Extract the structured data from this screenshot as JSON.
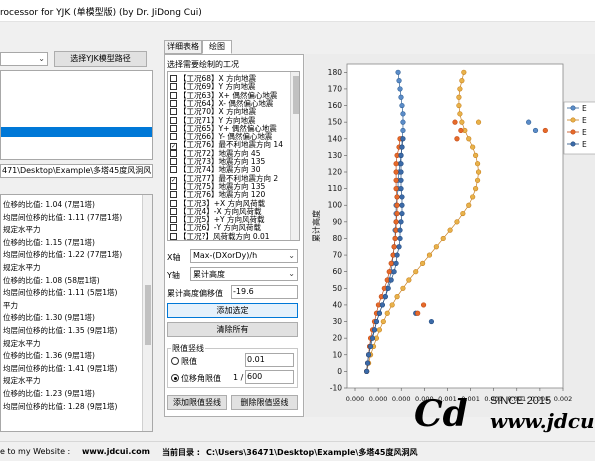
{
  "window": {
    "title": "rocessor for YJK (单模型版) (by Dr. JiDong Cui)"
  },
  "left": {
    "model_path_button": "选择YJK模型路径",
    "path_value": "471\\Desktop\\Example\\多塔45度风洞风",
    "results": [
      "位移的比值: 1.04 (7层1塔)",
      "均层间位移的比值: 1.11 (77层1塔)",
      "规定水平力",
      "位移的比值: 1.15 (7层1塔)",
      "均层间位移的比值: 1.22 (77层1塔)",
      "规定水平力",
      "位移的比值: 1.08 (58层1塔)",
      "均层间位移的比值: 1.11 (5层1塔)",
      "平力",
      "位移的比值: 1.30 (9层1塔)",
      "均层间位移的比值: 1.35 (9层1塔)",
      "规定水平力",
      "位移的比值: 1.36 (9层1塔)",
      "均层间位移的比值: 1.41 (9层1塔)",
      "规定水平力",
      "位移的比值: 1.23 (9层1塔)",
      "均层间位移的比值: 1.28 (9层1塔)"
    ]
  },
  "tabs": {
    "details": "详细表格",
    "plot": "绘图"
  },
  "panel": {
    "cases_label": "选择需要绘制的工况",
    "cases": [
      {
        "label": "【工况68】X 方向地震",
        "checked": false
      },
      {
        "label": "【工况69】Y 方向地震",
        "checked": false
      },
      {
        "label": "【工况63】X+ 偶然偏心地震",
        "checked": false
      },
      {
        "label": "【工况64】X- 偶然偏心地震",
        "checked": false
      },
      {
        "label": "【工况70】X 方向地震",
        "checked": false
      },
      {
        "label": "【工况71】Y 方向地震",
        "checked": false
      },
      {
        "label": "【工况65】Y+ 偶然偏心地震",
        "checked": false
      },
      {
        "label": "【工况66】Y- 偶然偏心地震",
        "checked": false
      },
      {
        "label": "【工况76】最不利地震方向 14",
        "checked": true
      },
      {
        "label": "【工况72】地震方向 45",
        "checked": false
      },
      {
        "label": "【工况73】地震方向 135",
        "checked": false
      },
      {
        "label": "【工况74】地震方向 30",
        "checked": false
      },
      {
        "label": "【工况77】最不利地震方向 2",
        "checked": true
      },
      {
        "label": "【工况75】地震方向 135",
        "checked": false
      },
      {
        "label": "【工况76】地震方向 120",
        "checked": false
      },
      {
        "label": "【工况3】+X 方向风荷载",
        "checked": false
      },
      {
        "label": "【工况4】-X 方向风荷载",
        "checked": false
      },
      {
        "label": "【工况5】+Y 方向风荷载",
        "checked": false
      },
      {
        "label": "【工况6】-Y 方向风荷载",
        "checked": false
      },
      {
        "label": "【工况?】风荷载方向 0.01",
        "checked": false
      }
    ],
    "x_axis_label": "X轴",
    "x_axis_value": "Max-(DXorDy)/h",
    "y_axis_label": "Y轴",
    "y_axis_value": "累计高度",
    "offset_label": "累计高度偏移值",
    "offset_value": "-19.6",
    "add_button": "添加选定",
    "clear_button": "清除所有",
    "limit_group_label": "限值竖线",
    "limit_option": "限值",
    "limit_value": "0.01",
    "drift_option": "位移角限值",
    "drift_prefix": "1 /",
    "drift_value": "600",
    "add_limit_button": "添加限值竖线",
    "remove_limit_button": "删除限值竖线"
  },
  "status": {
    "welcome": "e to my Website :",
    "site": "www.jdcui.com",
    "dir_label": "当前目录 :",
    "dir_value": "C:\\Users\\36471\\Desktop\\Example\\多塔45度风洞风"
  },
  "watermark": {
    "since": "SINCE 2015",
    "url": "www.jdcu"
  },
  "chart_data": {
    "type": "scatter",
    "ylabel": "累计高度",
    "xlabel": "",
    "ylim": [
      -10,
      185
    ],
    "xlim": [
      -0.0002,
      0.002
    ],
    "yticks": [
      -10,
      0,
      10,
      20,
      30,
      40,
      50,
      60,
      70,
      80,
      90,
      100,
      110,
      120,
      130,
      140,
      150,
      160,
      170,
      180
    ],
    "xticks": [
      "0.000",
      "0.000",
      "0.000",
      "0.000",
      "0.001",
      "0.001",
      "0.001",
      "0.001",
      "0.001",
      "0.002"
    ],
    "legend_entries": [
      "E",
      "E",
      "E",
      "E"
    ],
    "legend_placement": "right",
    "colors": {
      "blue": "#3a6fa8",
      "orange": "#e06a2a",
      "blue_fill": "#3d78b5",
      "orange_fill": "#f08030",
      "gold": "#d49a28"
    },
    "series": [
      {
        "color": "#2f5f95",
        "fill": "#5b8cc8",
        "y": [
          180,
          175,
          170,
          165,
          160,
          155,
          150,
          145,
          140,
          135,
          130,
          125,
          120,
          115,
          110,
          105,
          100,
          95,
          90,
          85,
          80,
          75,
          70,
          65,
          60,
          55,
          50,
          45,
          40,
          35,
          30,
          25,
          20,
          15,
          10,
          5,
          0
        ],
        "x": [
          0.00032,
          0.00033,
          0.00034,
          0.00035,
          0.00036,
          0.00037,
          0.00037,
          0.00037,
          0.00036,
          0.00036,
          0.00035,
          0.00034,
          0.00033,
          0.00032,
          0.00032,
          0.00031,
          0.0003,
          0.0003,
          0.0003,
          0.00029,
          0.00029,
          0.00028,
          0.00027,
          0.00026,
          0.00025,
          0.00023,
          0.00021,
          0.00019,
          0.00016,
          0.00013,
          0.0001,
          8e-05,
          5e-05,
          3e-05,
          2e-05,
          1e-05,
          0.0
        ]
      },
      {
        "color": "#c8801f",
        "fill": "#e8b24a",
        "y": [
          180,
          175,
          170,
          165,
          160,
          155,
          150,
          145,
          140,
          135,
          130,
          125,
          120,
          115,
          110,
          105,
          100,
          95,
          90,
          85,
          80,
          75,
          70,
          65,
          60,
          55,
          50,
          45,
          40,
          35,
          30,
          25,
          20,
          15,
          10,
          5,
          0
        ],
        "x": [
          0.00099,
          0.00097,
          0.00095,
          0.00094,
          0.00094,
          0.00095,
          0.00097,
          0.001,
          0.00104,
          0.00108,
          0.00111,
          0.00113,
          0.00114,
          0.00113,
          0.00111,
          0.00108,
          0.00104,
          0.00098,
          0.00092,
          0.00085,
          0.00078,
          0.00071,
          0.00064,
          0.00057,
          0.0005,
          0.00043,
          0.00037,
          0.00031,
          0.00026,
          0.00021,
          0.00017,
          0.00013,
          0.0001,
          7e-05,
          4e-05,
          2e-05,
          0.0
        ]
      },
      {
        "color": "#c04a15",
        "fill": "#e66a2a",
        "y": [
          140,
          135,
          130,
          125,
          120,
          115,
          110,
          105,
          100,
          95,
          90,
          85,
          80,
          75,
          70,
          65,
          60,
          55,
          50,
          45,
          40,
          35,
          30,
          25,
          20,
          15,
          10,
          5,
          0
        ],
        "x": [
          0.00034,
          0.00033,
          0.00031,
          0.0003,
          0.0003,
          0.0003,
          0.0003,
          0.00031,
          0.00031,
          0.00031,
          0.0003,
          0.0003,
          0.00029,
          0.00028,
          0.00027,
          0.00025,
          0.00023,
          0.00021,
          0.00018,
          0.00015,
          0.00012,
          0.0001,
          8e-05,
          6e-05,
          4e-05,
          3e-05,
          2e-05,
          1e-05,
          0.0
        ]
      },
      {
        "color": "#244d80",
        "fill": "#3b6aa8",
        "y": [
          140,
          135,
          130,
          125,
          120,
          115,
          110,
          105,
          100,
          95,
          90,
          85,
          80,
          75,
          70,
          65,
          60,
          55,
          50,
          45,
          40,
          35,
          30,
          25,
          20,
          15,
          10,
          5,
          0
        ],
        "x": [
          0.00037,
          0.00036,
          0.00035,
          0.00035,
          0.00035,
          0.00035,
          0.00035,
          0.00036,
          0.00036,
          0.00036,
          0.00035,
          0.00034,
          0.00034,
          0.00033,
          0.00031,
          0.0003,
          0.00028,
          0.00025,
          0.00022,
          0.00019,
          0.00016,
          0.00013,
          0.0001,
          8e-05,
          6e-05,
          4e-05,
          2e-05,
          1e-05,
          0.0
        ]
      }
    ],
    "outliers": [
      {
        "series": 0,
        "x": 0.00165,
        "y": 150
      },
      {
        "series": 0,
        "x": 0.00172,
        "y": 145
      },
      {
        "series": 1,
        "x": 0.00114,
        "y": 150
      },
      {
        "series": 2,
        "x": 0.0009,
        "y": 150
      },
      {
        "series": 2,
        "x": 0.00096,
        "y": 145
      },
      {
        "series": 2,
        "x": 0.00092,
        "y": 140
      },
      {
        "series": 2,
        "x": 0.00182,
        "y": 145
      },
      {
        "series": 3,
        "x": 0.0005,
        "y": 35
      },
      {
        "series": 3,
        "x": 0.00066,
        "y": 30
      },
      {
        "series": 2,
        "x": 0.00058,
        "y": 40
      },
      {
        "series": 2,
        "x": 0.00052,
        "y": 35
      }
    ]
  }
}
